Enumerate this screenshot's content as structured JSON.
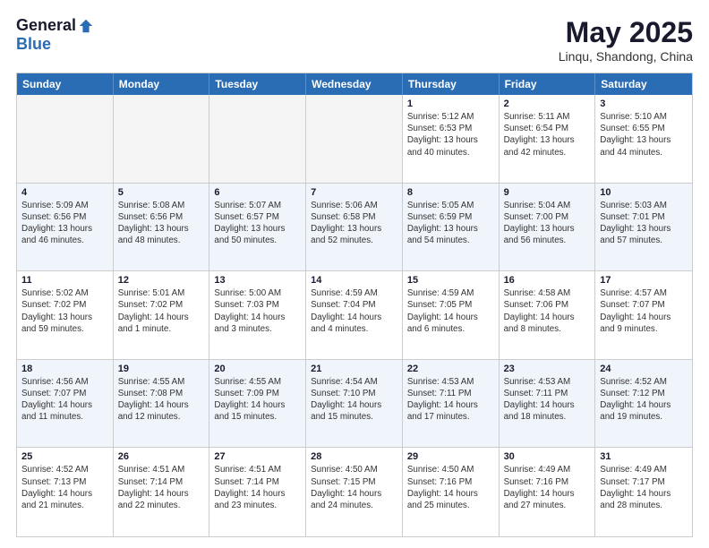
{
  "logo": {
    "general": "General",
    "blue": "Blue"
  },
  "title": "May 2025",
  "location": "Linqu, Shandong, China",
  "weekdays": [
    "Sunday",
    "Monday",
    "Tuesday",
    "Wednesday",
    "Thursday",
    "Friday",
    "Saturday"
  ],
  "rows": [
    [
      {
        "day": "",
        "text": "",
        "empty": true
      },
      {
        "day": "",
        "text": "",
        "empty": true
      },
      {
        "day": "",
        "text": "",
        "empty": true
      },
      {
        "day": "",
        "text": "",
        "empty": true
      },
      {
        "day": "1",
        "text": "Sunrise: 5:12 AM\nSunset: 6:53 PM\nDaylight: 13 hours\nand 40 minutes."
      },
      {
        "day": "2",
        "text": "Sunrise: 5:11 AM\nSunset: 6:54 PM\nDaylight: 13 hours\nand 42 minutes."
      },
      {
        "day": "3",
        "text": "Sunrise: 5:10 AM\nSunset: 6:55 PM\nDaylight: 13 hours\nand 44 minutes."
      }
    ],
    [
      {
        "day": "4",
        "text": "Sunrise: 5:09 AM\nSunset: 6:56 PM\nDaylight: 13 hours\nand 46 minutes."
      },
      {
        "day": "5",
        "text": "Sunrise: 5:08 AM\nSunset: 6:56 PM\nDaylight: 13 hours\nand 48 minutes."
      },
      {
        "day": "6",
        "text": "Sunrise: 5:07 AM\nSunset: 6:57 PM\nDaylight: 13 hours\nand 50 minutes."
      },
      {
        "day": "7",
        "text": "Sunrise: 5:06 AM\nSunset: 6:58 PM\nDaylight: 13 hours\nand 52 minutes."
      },
      {
        "day": "8",
        "text": "Sunrise: 5:05 AM\nSunset: 6:59 PM\nDaylight: 13 hours\nand 54 minutes."
      },
      {
        "day": "9",
        "text": "Sunrise: 5:04 AM\nSunset: 7:00 PM\nDaylight: 13 hours\nand 56 minutes."
      },
      {
        "day": "10",
        "text": "Sunrise: 5:03 AM\nSunset: 7:01 PM\nDaylight: 13 hours\nand 57 minutes."
      }
    ],
    [
      {
        "day": "11",
        "text": "Sunrise: 5:02 AM\nSunset: 7:02 PM\nDaylight: 13 hours\nand 59 minutes."
      },
      {
        "day": "12",
        "text": "Sunrise: 5:01 AM\nSunset: 7:02 PM\nDaylight: 14 hours\nand 1 minute."
      },
      {
        "day": "13",
        "text": "Sunrise: 5:00 AM\nSunset: 7:03 PM\nDaylight: 14 hours\nand 3 minutes."
      },
      {
        "day": "14",
        "text": "Sunrise: 4:59 AM\nSunset: 7:04 PM\nDaylight: 14 hours\nand 4 minutes."
      },
      {
        "day": "15",
        "text": "Sunrise: 4:59 AM\nSunset: 7:05 PM\nDaylight: 14 hours\nand 6 minutes."
      },
      {
        "day": "16",
        "text": "Sunrise: 4:58 AM\nSunset: 7:06 PM\nDaylight: 14 hours\nand 8 minutes."
      },
      {
        "day": "17",
        "text": "Sunrise: 4:57 AM\nSunset: 7:07 PM\nDaylight: 14 hours\nand 9 minutes."
      }
    ],
    [
      {
        "day": "18",
        "text": "Sunrise: 4:56 AM\nSunset: 7:07 PM\nDaylight: 14 hours\nand 11 minutes."
      },
      {
        "day": "19",
        "text": "Sunrise: 4:55 AM\nSunset: 7:08 PM\nDaylight: 14 hours\nand 12 minutes."
      },
      {
        "day": "20",
        "text": "Sunrise: 4:55 AM\nSunset: 7:09 PM\nDaylight: 14 hours\nand 15 minutes."
      },
      {
        "day": "21",
        "text": "Sunrise: 4:54 AM\nSunset: 7:10 PM\nDaylight: 14 hours\nand 15 minutes."
      },
      {
        "day": "22",
        "text": "Sunrise: 4:53 AM\nSunset: 7:11 PM\nDaylight: 14 hours\nand 17 minutes."
      },
      {
        "day": "23",
        "text": "Sunrise: 4:53 AM\nSunset: 7:11 PM\nDaylight: 14 hours\nand 18 minutes."
      },
      {
        "day": "24",
        "text": "Sunrise: 4:52 AM\nSunset: 7:12 PM\nDaylight: 14 hours\nand 19 minutes."
      }
    ],
    [
      {
        "day": "25",
        "text": "Sunrise: 4:52 AM\nSunset: 7:13 PM\nDaylight: 14 hours\nand 21 minutes."
      },
      {
        "day": "26",
        "text": "Sunrise: 4:51 AM\nSunset: 7:14 PM\nDaylight: 14 hours\nand 22 minutes."
      },
      {
        "day": "27",
        "text": "Sunrise: 4:51 AM\nSunset: 7:14 PM\nDaylight: 14 hours\nand 23 minutes."
      },
      {
        "day": "28",
        "text": "Sunrise: 4:50 AM\nSunset: 7:15 PM\nDaylight: 14 hours\nand 24 minutes."
      },
      {
        "day": "29",
        "text": "Sunrise: 4:50 AM\nSunset: 7:16 PM\nDaylight: 14 hours\nand 25 minutes."
      },
      {
        "day": "30",
        "text": "Sunrise: 4:49 AM\nSunset: 7:16 PM\nDaylight: 14 hours\nand 27 minutes."
      },
      {
        "day": "31",
        "text": "Sunrise: 4:49 AM\nSunset: 7:17 PM\nDaylight: 14 hours\nand 28 minutes."
      }
    ]
  ]
}
